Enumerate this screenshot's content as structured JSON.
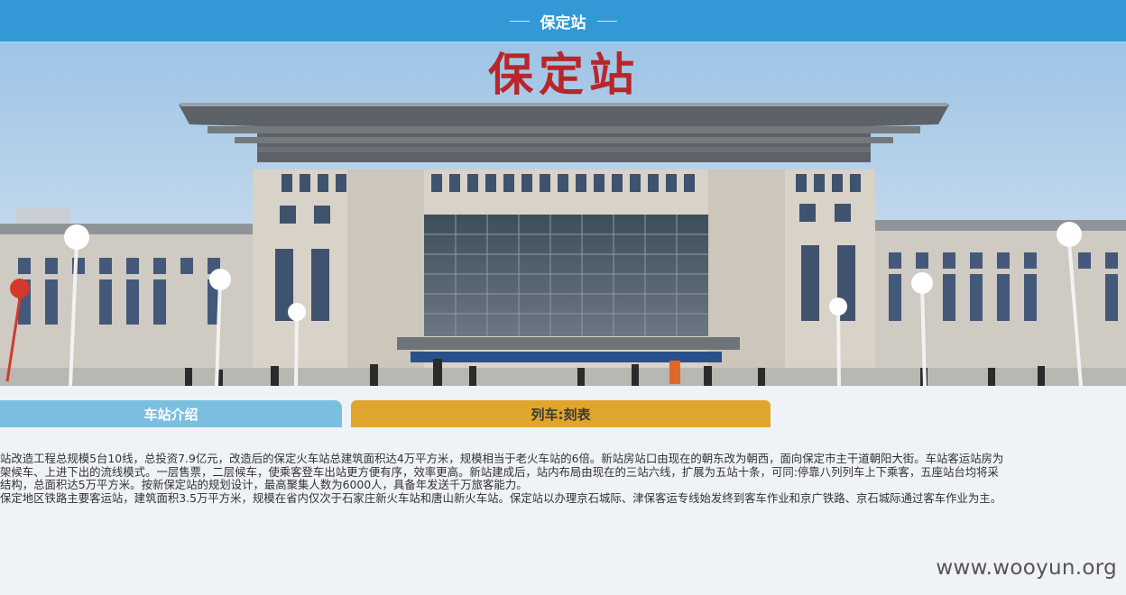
{
  "header": {
    "title": "保定站"
  },
  "hero": {
    "sign_text": "保定站"
  },
  "tabs": [
    {
      "label": "车站介绍",
      "color": "#7bbfe0"
    },
    {
      "label": "列车:刻表",
      "color": "#e0a52c"
    }
  ],
  "description": [
    "站改造工程总规模5台10线，总投资7.9亿元，改造后的保定火车站总建筑面积达4万平方米，规模相当于老火车站的6倍。新站房站口由现在的朝东改为朝西，面向保定市主干道朝阳大街。车站客运站房为",
    "架候车、上进下出的流线模式。一层售票，二层候车，使乘客登车出站更方便有序，效率更高。新站建成后，站内布局由现在的三站六线，扩展为五站十条，可同:停靠八列列车上下乘客，五座站台均将采",
    "结构，总面积达5万平方米。按新保定站的规划设计，最高聚集人数为6000人，具备年发送千万旅客能力。",
    "保定地区铁路主要客运站，建筑面积3.5万平方米，规模在省内仅次于石家庄新火车站和唐山新火车站。保定站以办理京石城际、津保客运专线始发终到客车作业和京广铁路、京石城际通过客车作业为主。"
  ],
  "watermark": "www.wooyun.org",
  "colors": {
    "header_bg": "#3399d6",
    "page_bg": "#eff2f6",
    "sign_red": "#b8262a"
  }
}
